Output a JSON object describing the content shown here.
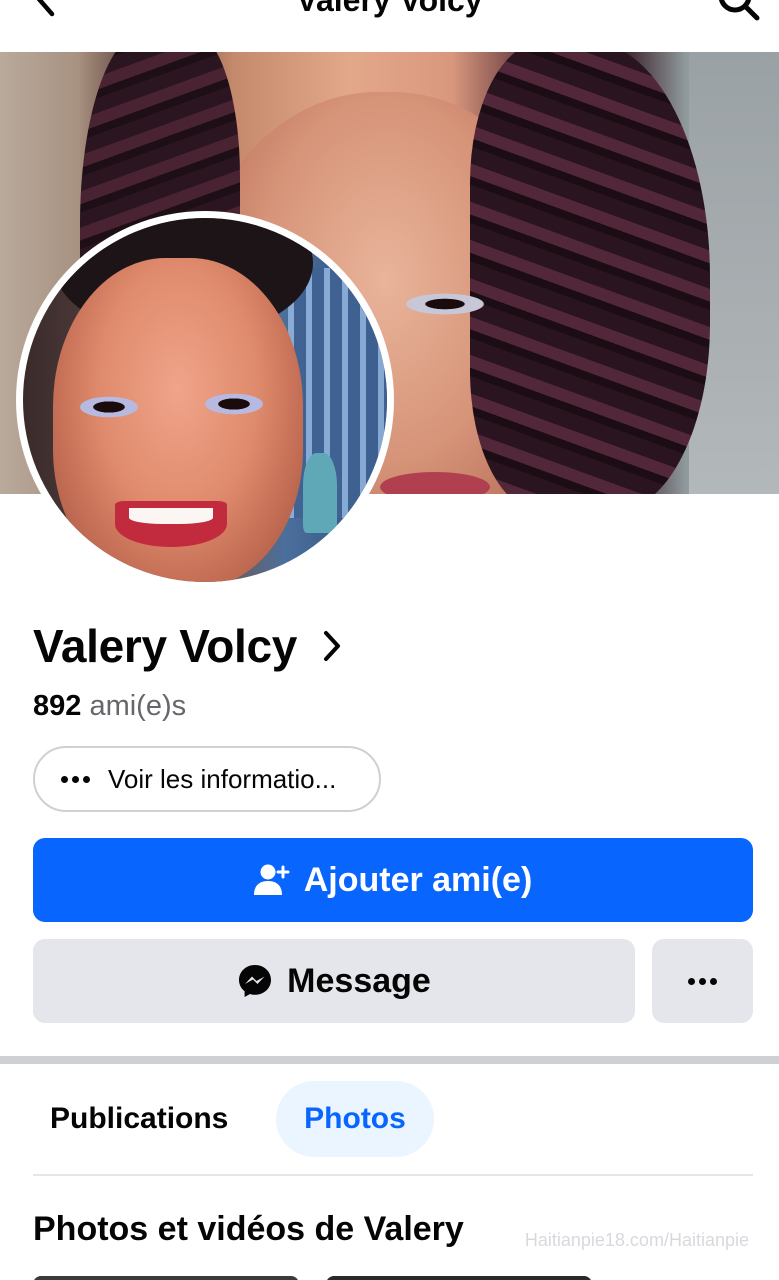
{
  "header": {
    "title": "Valery Volcy",
    "back_icon": "chevron-left-icon",
    "search_icon": "search-icon"
  },
  "profile": {
    "name": "Valery Volcy",
    "friend_count": "892",
    "friend_label": "ami(e)s"
  },
  "actions": {
    "info_label": "Voir les informatio...",
    "add_friend_label": "Ajouter ami(e)",
    "message_label": "Message"
  },
  "tabs": [
    {
      "label": "Publications",
      "active": false
    },
    {
      "label": "Photos",
      "active": true
    }
  ],
  "section": {
    "title": "Photos et vidéos de Valery"
  },
  "watermark": "Haitianpie18.com/Haitianpie",
  "colors": {
    "primary": "#0866ff",
    "secondary_button": "#e4e6eb",
    "active_tab_bg": "#ebf5ff",
    "muted_text": "#65676b"
  }
}
